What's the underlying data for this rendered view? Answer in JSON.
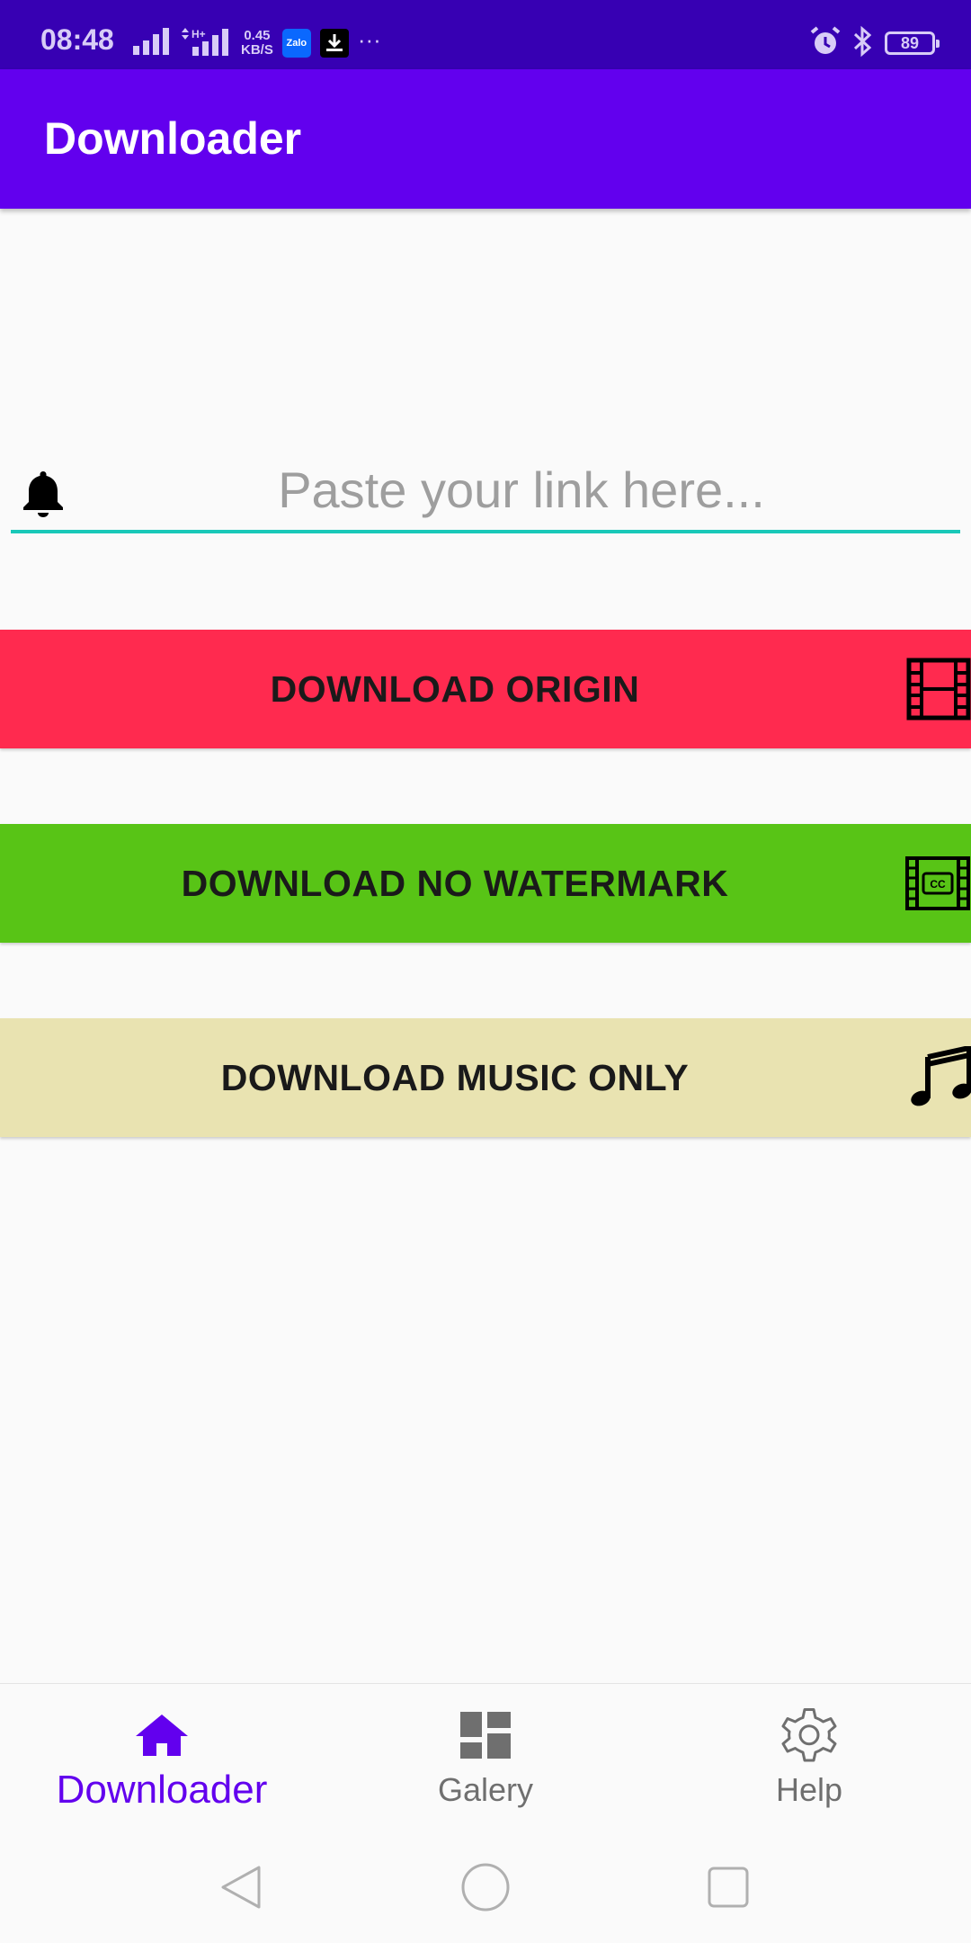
{
  "status_bar": {
    "time": "08:48",
    "net_speed_value": "0.45",
    "net_speed_unit": "KB/S",
    "zalo_label": "Zalo",
    "more": "···",
    "battery": "89",
    "icons": [
      "signal-icon",
      "signal-h-plus-icon",
      "zalo-icon",
      "download-notification-icon",
      "alarm-icon",
      "bluetooth-icon",
      "battery-icon"
    ]
  },
  "app_bar": {
    "title": "Downloader"
  },
  "link_input": {
    "placeholder": "Paste your link here...",
    "value": "",
    "icon": "bell-icon",
    "underline_color": "#19c8b8"
  },
  "buttons": {
    "origin": {
      "label": "DOWNLOAD ORIGIN",
      "color": "#ff2a4f",
      "icon": "film-icon"
    },
    "no_watermark": {
      "label": "DOWNLOAD NO WATERMARK",
      "color": "#58c416",
      "icon": "movie-cc-icon"
    },
    "music": {
      "label": "DOWNLOAD MUSIC ONLY",
      "color": "#e9e3b1",
      "icon": "music-note-icon"
    }
  },
  "bottom_nav": {
    "items": [
      {
        "label": "Downloader",
        "icon": "home-icon",
        "active": true
      },
      {
        "label": "Galery",
        "icon": "dashboard-icon",
        "active": false
      },
      {
        "label": "Help",
        "icon": "gear-icon",
        "active": false
      }
    ],
    "active_color": "#6200ee"
  },
  "theme": {
    "status_bar": "#3700b3",
    "primary": "#6200ee"
  }
}
